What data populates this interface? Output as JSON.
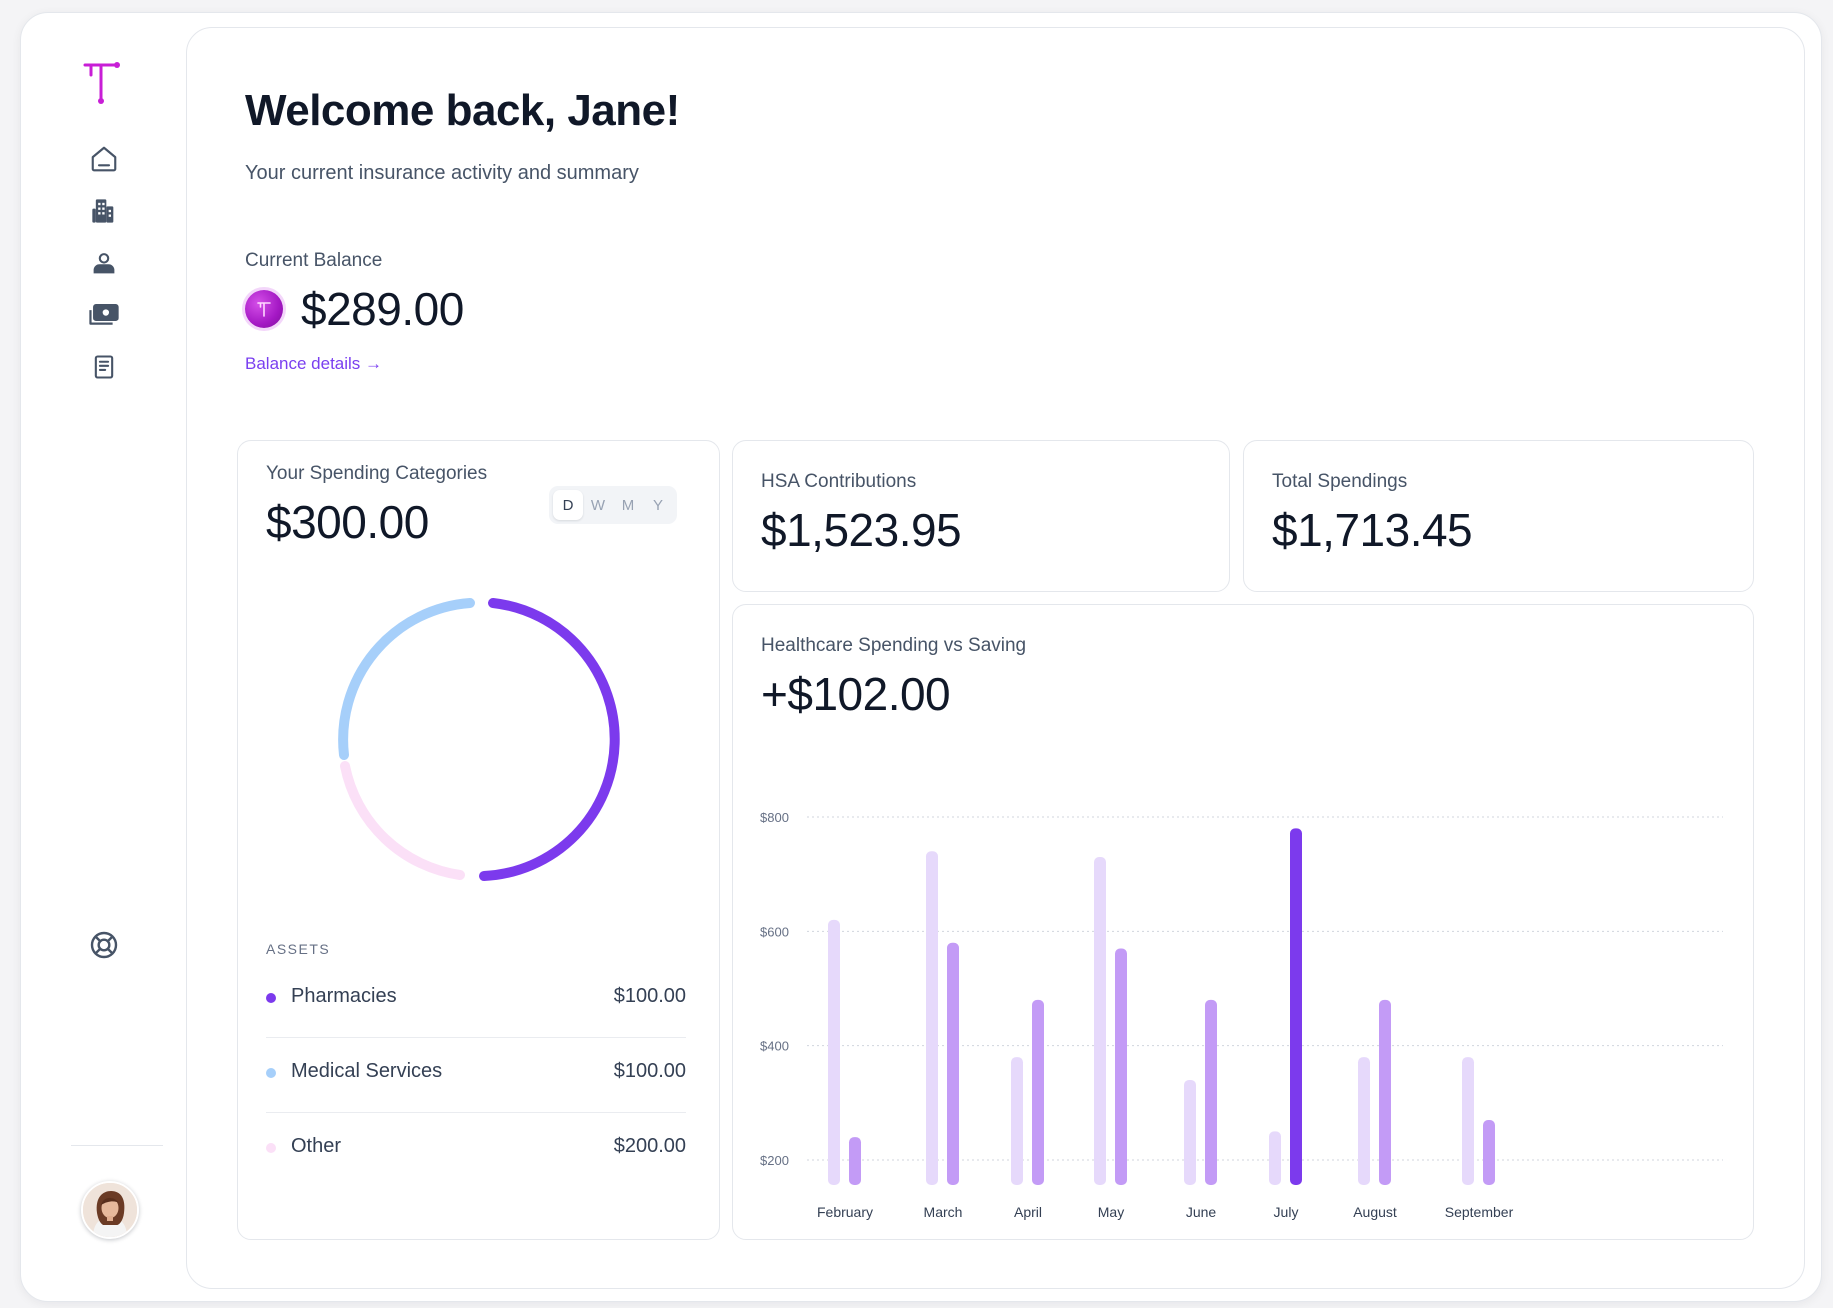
{
  "sidebar": {
    "logo": "t-logo-icon",
    "nav": [
      {
        "icon": "home-icon"
      },
      {
        "icon": "building-icon"
      },
      {
        "icon": "user-icon"
      },
      {
        "icon": "cash-icon"
      },
      {
        "icon": "document-icon"
      }
    ],
    "support_icon": "lifebuoy-icon",
    "avatar_icon": "user-avatar"
  },
  "header": {
    "title": "Welcome back, Jane!",
    "subtitle": "Your current insurance activity and summary"
  },
  "balance": {
    "label": "Current Balance",
    "amount": "$289.00",
    "link": "Balance details →"
  },
  "spending_categories": {
    "label": "Your Spending Categories",
    "amount": "$300.00",
    "toggle": [
      "D",
      "W",
      "M",
      "Y"
    ],
    "selected": "D",
    "assets_title": "ASSETS",
    "assets": [
      {
        "name": "Pharmacies",
        "value": "$100.00",
        "color": "#7c3aed"
      },
      {
        "name": "Medical Services",
        "value": "$100.00",
        "color": "#a6cffa"
      },
      {
        "name": "Other",
        "value": "$200.00",
        "color": "#fbe0f7"
      }
    ]
  },
  "hsa": {
    "label": "HSA Contributions",
    "amount": "$1,523.95"
  },
  "total_spendings": {
    "label": "Total Spendings",
    "amount": "$1,713.45"
  },
  "healthcare_chart": {
    "label": "Healthcare Spending vs Saving",
    "amount": "+$102.00"
  },
  "chart_data": {
    "type": "bar",
    "categories": [
      "February",
      "March",
      "April",
      "May",
      "June",
      "July",
      "August",
      "September"
    ],
    "series": [
      {
        "values": [
          620,
          740,
          380,
          730,
          340,
          250,
          380,
          380
        ],
        "color": "#e6d9fb"
      },
      {
        "values": [
          240,
          580,
          480,
          570,
          480,
          780,
          480,
          270
        ],
        "color": "#c39bf6"
      }
    ],
    "highlight": {
      "category": "July",
      "series": 1,
      "color": "#7c3aed"
    },
    "y_ticks": [
      "$200",
      "$400",
      "$600",
      "$800"
    ],
    "y_tick_values": [
      200,
      400,
      600,
      800
    ],
    "grid": true,
    "grid_style": "dotted"
  }
}
